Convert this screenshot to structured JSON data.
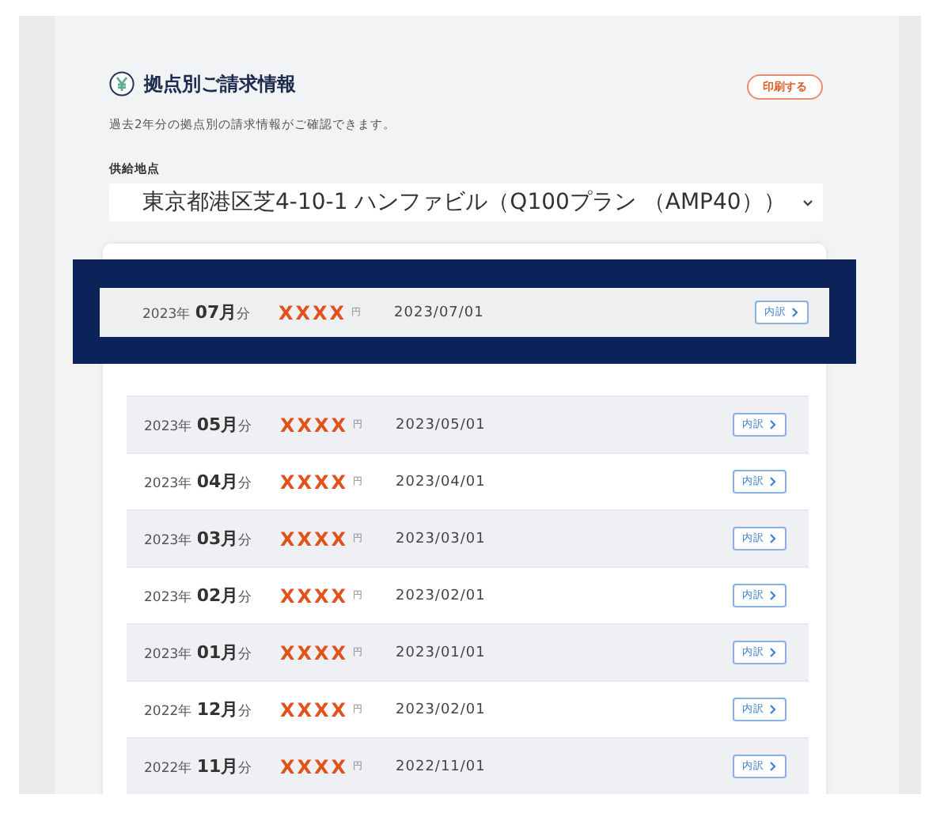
{
  "header": {
    "title": "拠点別ご請求情報",
    "print_button": "印刷する",
    "description": "過去2年分の拠点別の請求情報がご確認できます。"
  },
  "supply_point": {
    "label": "供給地点",
    "value": "東京都港区芝4-10-1 ハンファビル（Q100プラン （AMP40））"
  },
  "highlighted_row": {
    "month": "2023年 **07月**分",
    "amount": "XXXX",
    "unit": "円",
    "date": "2023/07/01",
    "button": "内訳"
  },
  "rows": [
    {
      "month": "2023年 **05月**分",
      "amount": "XXXX",
      "unit": "円",
      "date": "2023/05/01",
      "button": "内訳"
    },
    {
      "month": "2023年 **04月**分",
      "amount": "XXXX",
      "unit": "円",
      "date": "2023/04/01",
      "button": "内訳"
    },
    {
      "month": "2023年 **03月**分",
      "amount": "XXXX",
      "unit": "円",
      "date": "2023/03/01",
      "button": "内訳"
    },
    {
      "month": "2023年 **02月**分",
      "amount": "XXXX",
      "unit": "円",
      "date": "2023/02/01",
      "button": "内訳"
    },
    {
      "month": "2023年 **01月**分",
      "amount": "XXXX",
      "unit": "円",
      "date": "2023/01/01",
      "button": "内訳"
    },
    {
      "month": "2022年 **12月**分",
      "amount": "XXXX",
      "unit": "円",
      "date": "2023/02/01",
      "button": "内訳"
    },
    {
      "month": "2022年 **11月**分",
      "amount": "XXXX",
      "unit": "円",
      "date": "2022/11/01",
      "button": "内訳"
    }
  ]
}
